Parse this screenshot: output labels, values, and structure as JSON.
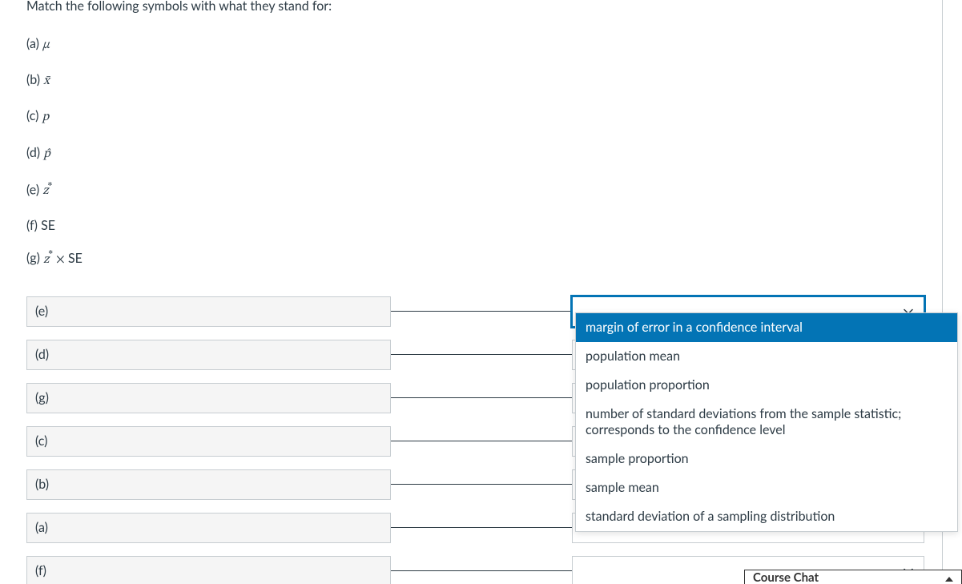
{
  "instruction": "Match the following symbols with what they stand for:",
  "symbols": [
    {
      "label": "(a)",
      "glyph": "μ",
      "italic": true
    },
    {
      "label": "(b)",
      "glyph": "x̄",
      "italic": true
    },
    {
      "label": "(c)",
      "glyph": "p",
      "italic": true
    },
    {
      "label": "(d)",
      "glyph": "p̂",
      "italic": true
    },
    {
      "label": "(e)",
      "glyph": "z*",
      "italic": true
    },
    {
      "label": "(f)",
      "glyph": "SE",
      "italic": false
    },
    {
      "label": "(g)",
      "glyph": "z* × SE",
      "italic": true,
      "mixed": true
    }
  ],
  "match_rows": [
    {
      "label": "(e)",
      "focused": true
    },
    {
      "label": "(d)",
      "focused": false
    },
    {
      "label": "(g)",
      "focused": false
    },
    {
      "label": "(c)",
      "focused": false
    },
    {
      "label": "(b)",
      "focused": false
    },
    {
      "label": "(a)",
      "focused": false
    },
    {
      "label": "(f)",
      "focused": false
    }
  ],
  "dropdown_options": [
    "margin of error in a confidence interval",
    "population mean",
    "population proportion",
    "number of standard deviations from the sample statistic; corresponds to the confidence level",
    "sample proportion",
    "sample mean",
    "standard deviation of a sampling distribution"
  ],
  "dropdown_highlight_index": 0,
  "course_chat_label": "Course Chat"
}
